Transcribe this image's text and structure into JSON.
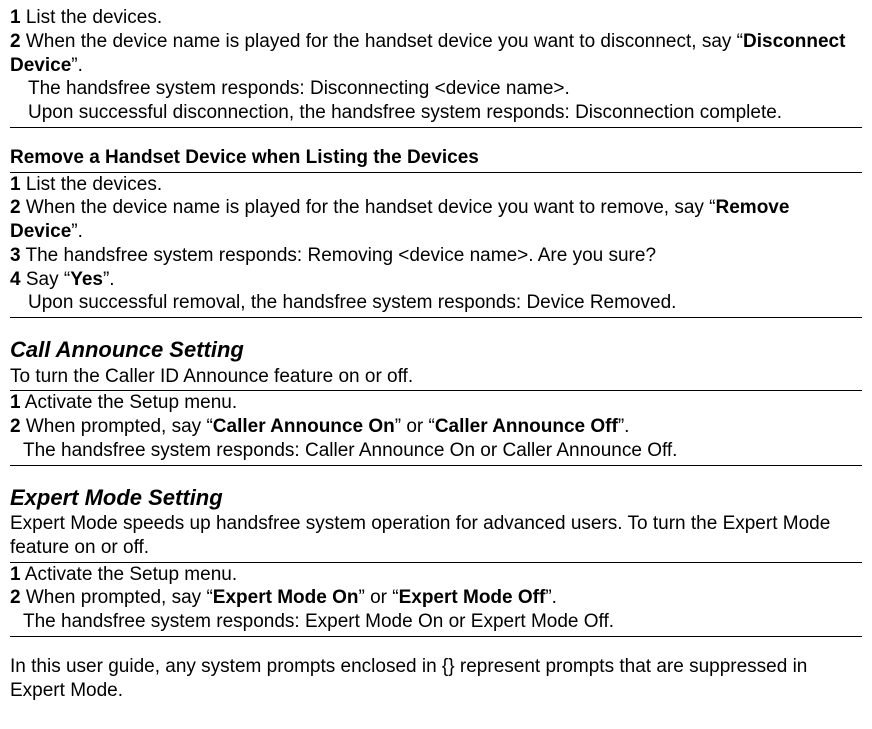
{
  "section1": {
    "step1_num": "1",
    "step1_text": " List the devices.",
    "step2_num": "2",
    "step2_prefix": " When the device name is played for the handset device you want to disconnect, say “",
    "step2_bold": "Disconnect Device",
    "step2_suffix": "”.",
    "sub1": "The handsfree system responds: Disconnecting <device name>.",
    "sub2": "Upon successful disconnection, the handsfree system responds: Disconnection complete."
  },
  "section2": {
    "heading": "Remove a Handset Device when Listing the Devices",
    "step1_num": "1",
    "step1_text": " List the devices.",
    "step2_num": "2",
    "step2_prefix": " When the device name is played for the handset device you want to remove, say “",
    "step2_bold": "Remove Device",
    "step2_suffix": "”.",
    "step3_num": "3",
    "step3_text": " The handsfree system responds: Removing <device name>. Are you sure?",
    "step4_num": "4",
    "step4_prefix": " Say “",
    "step4_bold": "Yes",
    "step4_suffix": "”.",
    "sub1": "Upon successful removal, the handsfree system responds: Device Removed."
  },
  "section3": {
    "heading": "Call Announce Setting",
    "intro": "To turn the Caller ID Announce feature on or off.",
    "step1_num": "1",
    "step1_text": " Activate the Setup menu.",
    "step2_num": "2",
    "step2_prefix": " When prompted, say “",
    "step2_bold1": "Caller Announce On",
    "step2_mid": "” or “",
    "step2_bold2": "Caller Announce Off",
    "step2_suffix": "”.",
    "sub1": "The handsfree system responds: Caller Announce On or Caller Announce Off."
  },
  "section4": {
    "heading": "Expert Mode Setting",
    "intro": "Expert Mode speeds up handsfree system operation for advanced users. To turn the Expert Mode feature on or off.",
    "step1_num": "1",
    "step1_text": " Activate the Setup menu.",
    "step2_num": "2",
    "step2_prefix": " When prompted, say “",
    "step2_bold1": "Expert Mode On",
    "step2_mid": "” or “",
    "step2_bold2": "Expert Mode Off",
    "step2_suffix": "”.",
    "sub1": "The handsfree system responds: Expert Mode On or Expert Mode Off."
  },
  "footer": {
    "text": "In this user guide, any system prompts enclosed in {} represent prompts that are suppressed in Expert Mode."
  }
}
